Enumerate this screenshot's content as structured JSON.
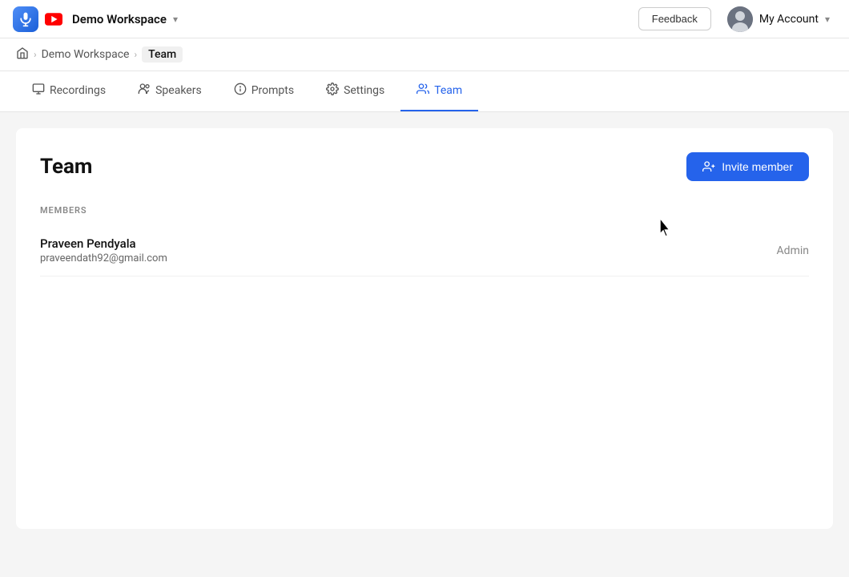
{
  "app": {
    "icon_label": "app-icon",
    "workspace_name": "Demo Workspace"
  },
  "topnav": {
    "feedback_label": "Feedback",
    "account_label": "My Account",
    "chevron": "▾"
  },
  "breadcrumb": {
    "home_label": "🏠",
    "separator": ">",
    "workspace": "Demo Workspace",
    "current": "Team"
  },
  "tabs": [
    {
      "id": "recordings",
      "label": "Recordings",
      "icon": "⬜",
      "active": false
    },
    {
      "id": "speakers",
      "label": "Speakers",
      "icon": "👥",
      "active": false
    },
    {
      "id": "prompts",
      "label": "Prompts",
      "icon": "💡",
      "active": false
    },
    {
      "id": "settings",
      "label": "Settings",
      "icon": "⚙️",
      "active": false
    },
    {
      "id": "team",
      "label": "Team",
      "icon": "👤",
      "active": true
    }
  ],
  "main": {
    "title": "Team",
    "invite_button": "Invite member",
    "members_section_label": "MEMBERS",
    "members": [
      {
        "name": "Praveen Pendyala",
        "email": "praveendath92@gmail.com",
        "role": "Admin"
      }
    ]
  }
}
